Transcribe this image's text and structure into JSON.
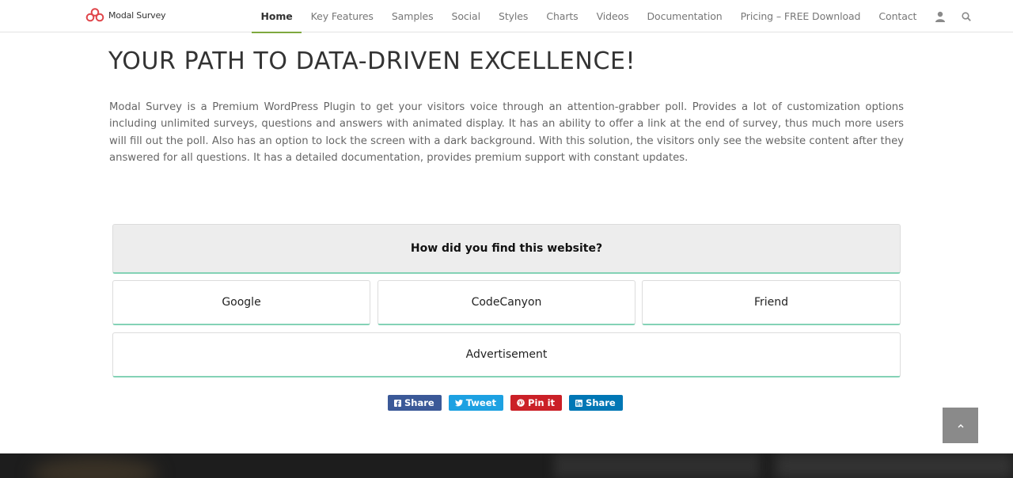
{
  "header": {
    "logo_text": "Modal Survey",
    "nav": [
      {
        "label": "Home",
        "active": true
      },
      {
        "label": "Key Features"
      },
      {
        "label": "Samples"
      },
      {
        "label": "Social"
      },
      {
        "label": "Styles"
      },
      {
        "label": "Charts"
      },
      {
        "label": "Videos"
      },
      {
        "label": "Documentation"
      },
      {
        "label": "Pricing – FREE Download"
      },
      {
        "label": "Contact"
      }
    ],
    "icons": [
      "user-icon",
      "search-icon"
    ]
  },
  "main": {
    "headline": "YOUR PATH TO DATA-DRIVEN EXCELLENCE!",
    "intro": "Modal Survey is a Premium WordPress Plugin to get your visitors voice through an attention-grabber poll. Provides a lot of customization options including unlimited surveys, questions and answers with animated display. It has an ability to offer a link at the end of survey, thus much more users will fill out the poll. Also has an option to lock the screen with a dark background. With this solution, the visitors only see the website content after they answered for all questions. It has a detailed documentation, provides premium support with constant updates."
  },
  "survey": {
    "question": "How did you find this website?",
    "answers": [
      "Google",
      "CodeCanyon",
      "Friend",
      "Advertisement"
    ]
  },
  "share": [
    {
      "label": "Share",
      "icon": "facebook-icon",
      "color": "#3b5998"
    },
    {
      "label": "Tweet",
      "icon": "twitter-icon",
      "color": "#1da1e2"
    },
    {
      "label": "Pin it",
      "icon": "pinterest-icon",
      "color": "#cb2027"
    },
    {
      "label": "Share",
      "icon": "linkedin-icon",
      "color": "#0077b5"
    }
  ],
  "colors": {
    "accent": "#7ea83e",
    "answer_border": "#84d2b6",
    "to_top": "#8a8a8a"
  }
}
